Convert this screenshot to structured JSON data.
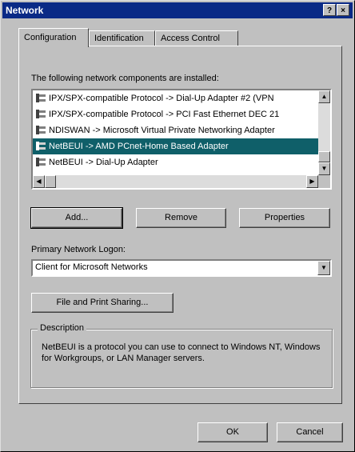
{
  "window": {
    "title": "Network",
    "help_button": "?",
    "close_button": "×"
  },
  "tabs": [
    {
      "label": "Configuration",
      "active": true
    },
    {
      "label": "Identification",
      "active": false
    },
    {
      "label": "Access Control",
      "active": false
    }
  ],
  "components": {
    "label": "The following network components are installed:",
    "items": [
      {
        "label": "IPX/SPX-compatible Protocol -> Dial-Up Adapter #2 (VPN",
        "icon": "protocol-icon",
        "selected": false
      },
      {
        "label": "IPX/SPX-compatible Protocol -> PCI Fast Ethernet DEC 21",
        "icon": "protocol-icon",
        "selected": false
      },
      {
        "label": "NDISWAN -> Microsoft Virtual Private Networking Adapter",
        "icon": "protocol-icon",
        "selected": false
      },
      {
        "label": "NetBEUI -> AMD PCnet-Home Based Adapter",
        "icon": "protocol-icon",
        "selected": true
      },
      {
        "label": "NetBEUI -> Dial-Up Adapter",
        "icon": "protocol-icon",
        "selected": false
      }
    ]
  },
  "buttons": {
    "add": "Add...",
    "remove": "Remove",
    "properties": "Properties",
    "file_print_sharing": "File and Print Sharing...",
    "ok": "OK",
    "cancel": "Cancel"
  },
  "logon": {
    "label": "Primary Network Logon:",
    "value": "Client for Microsoft Networks"
  },
  "description": {
    "title": "Description",
    "text": "NetBEUI is a protocol you can use to connect to Windows NT, Windows for Workgroups, or LAN Manager servers."
  },
  "colors": {
    "titlebar": "#0a2a86",
    "selection": "#0f5f69",
    "face": "#c0c0c0"
  }
}
